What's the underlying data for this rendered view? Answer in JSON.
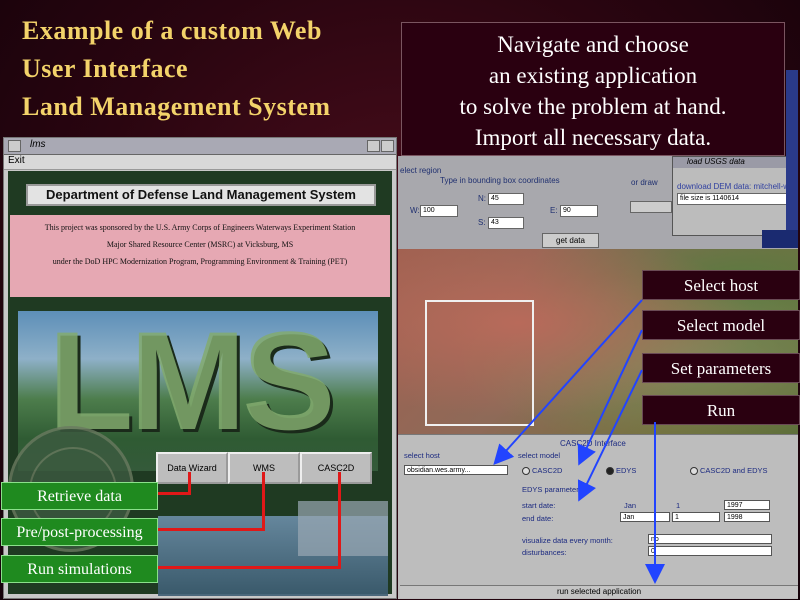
{
  "slide": {
    "title_lines": [
      "Example of a custom Web",
      "User Interface",
      "Land Management System"
    ],
    "callout_lines": [
      "Navigate and choose",
      "an existing application",
      "to solve the problem at hand.",
      "Import all necessary data."
    ],
    "steps": [
      "Select host",
      "Select model",
      "Set parameters",
      "Run"
    ],
    "green_buttons": [
      "Retrieve data",
      "Pre/post-processing",
      "Run simulations"
    ]
  },
  "lms_window": {
    "title": "lms",
    "menu": "Exit",
    "banner": "Department of Defense Land Management System",
    "sponsor_lines": [
      "This project was sponsored by the U.S. Army Corps of Engineers Waterways Experiment Station",
      "Major Shared Resource Center (MSRC) at Vicksburg, MS",
      "under the DoD HPC Modernization Program, Programming Environment & Training (PET)"
    ],
    "logo_text": "LMS",
    "buttons": [
      "Data Wizard",
      "WMS",
      "CASC2D"
    ]
  },
  "select_region": {
    "heading": "elect region",
    "subheading": "Type in bounding box coordinates",
    "or_draw": "or draw",
    "n_label": "N:",
    "n_value": "45",
    "w_label": "W:",
    "w_value": "100",
    "e_label": "E:",
    "e_value": "90",
    "s_label": "S:",
    "s_value": "43",
    "get_data": "get data"
  },
  "usgs_window": {
    "title": "load USGS data",
    "label": "download DEM data: mitchell-w",
    "value": "file size is 1140614"
  },
  "casc2d": {
    "title": "CASC2D Interface",
    "select_host_label": "select host",
    "host_value": "obsidian.wes.army...",
    "select_model_label": "select model",
    "models": [
      "CASC2D",
      "EDYS",
      "CASC2D and EDYS"
    ],
    "selected_model": "EDYS",
    "params_label": "EDYS parameters",
    "start_label": "start date:",
    "start_month": "Jan",
    "start_day": "1",
    "start_year": "1997",
    "end_label": "end date:",
    "end_month": "Jan",
    "end_day": "1",
    "end_year": "1998",
    "visualize_label": "visualize data every month:",
    "visualize_value": "no",
    "disturbances_label": "disturbances:",
    "disturbances_value": "0",
    "run_button": "run selected application"
  }
}
